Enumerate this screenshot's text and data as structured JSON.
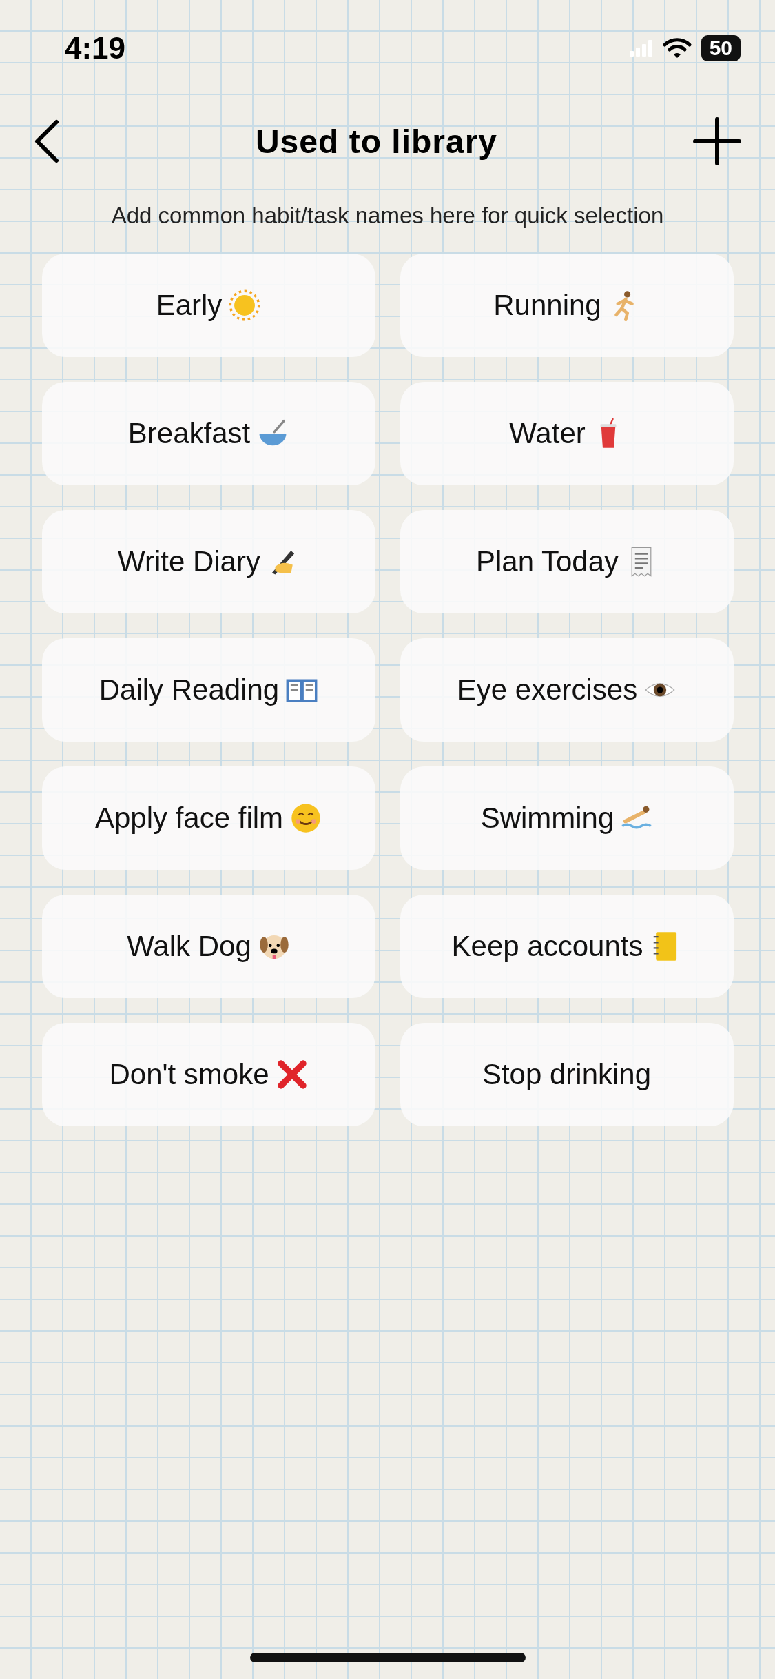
{
  "status_bar": {
    "time": "4:19",
    "battery": "50"
  },
  "header": {
    "title": "Used to library"
  },
  "subtitle": "Add common habit/task names here for quick selection",
  "items": [
    {
      "label": "Early",
      "kind": "sun"
    },
    {
      "label": "Running",
      "kind": "runner"
    },
    {
      "label": "Breakfast",
      "kind": "bowl"
    },
    {
      "label": "Water",
      "kind": "cup"
    },
    {
      "label": "Write Diary",
      "kind": "writing"
    },
    {
      "label": "Plan Today",
      "kind": "receipt"
    },
    {
      "label": "Daily Reading",
      "kind": "book"
    },
    {
      "label": "Eye exercises",
      "kind": "eye"
    },
    {
      "label": "Apply face film",
      "kind": "smile"
    },
    {
      "label": "Swimming",
      "kind": "swimmer"
    },
    {
      "label": "Walk Dog",
      "kind": "dog"
    },
    {
      "label": "Keep accounts",
      "kind": "notebook"
    },
    {
      "label": "Don't smoke",
      "kind": "cross"
    },
    {
      "label": "Stop drinking",
      "kind": "none"
    }
  ]
}
